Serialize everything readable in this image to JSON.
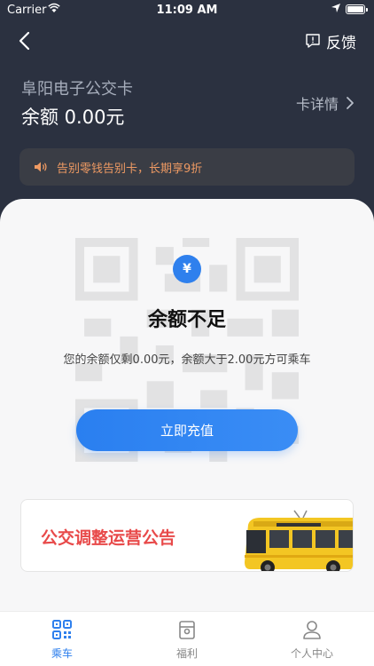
{
  "status_bar": {
    "carrier": "Carrier",
    "time": "11:09 AM"
  },
  "nav": {
    "feedback_label": "反馈"
  },
  "card": {
    "title": "阜阳电子公交卡",
    "balance": "余额 0.00元",
    "detail_label": "卡详情"
  },
  "notice": {
    "text": "告别零钱告别卡，长期享9折"
  },
  "main": {
    "yen_symbol": "¥",
    "title": "余额不足",
    "description": "您的余额仅剩0.00元，余额大于2.00元方可乘车",
    "recharge_label": "立即充值"
  },
  "announcement": {
    "text": "公交调整运营公告"
  },
  "tabs": [
    {
      "label": "乘车",
      "icon": "qr-icon",
      "active": true
    },
    {
      "label": "福利",
      "icon": "gift-icon",
      "active": false
    },
    {
      "label": "个人中心",
      "icon": "person-icon",
      "active": false
    }
  ],
  "colors": {
    "accent": "#2f80ed",
    "header_bg": "#2b3140",
    "notice_text": "#ee9a63",
    "announcement_text": "#e84a4a"
  }
}
